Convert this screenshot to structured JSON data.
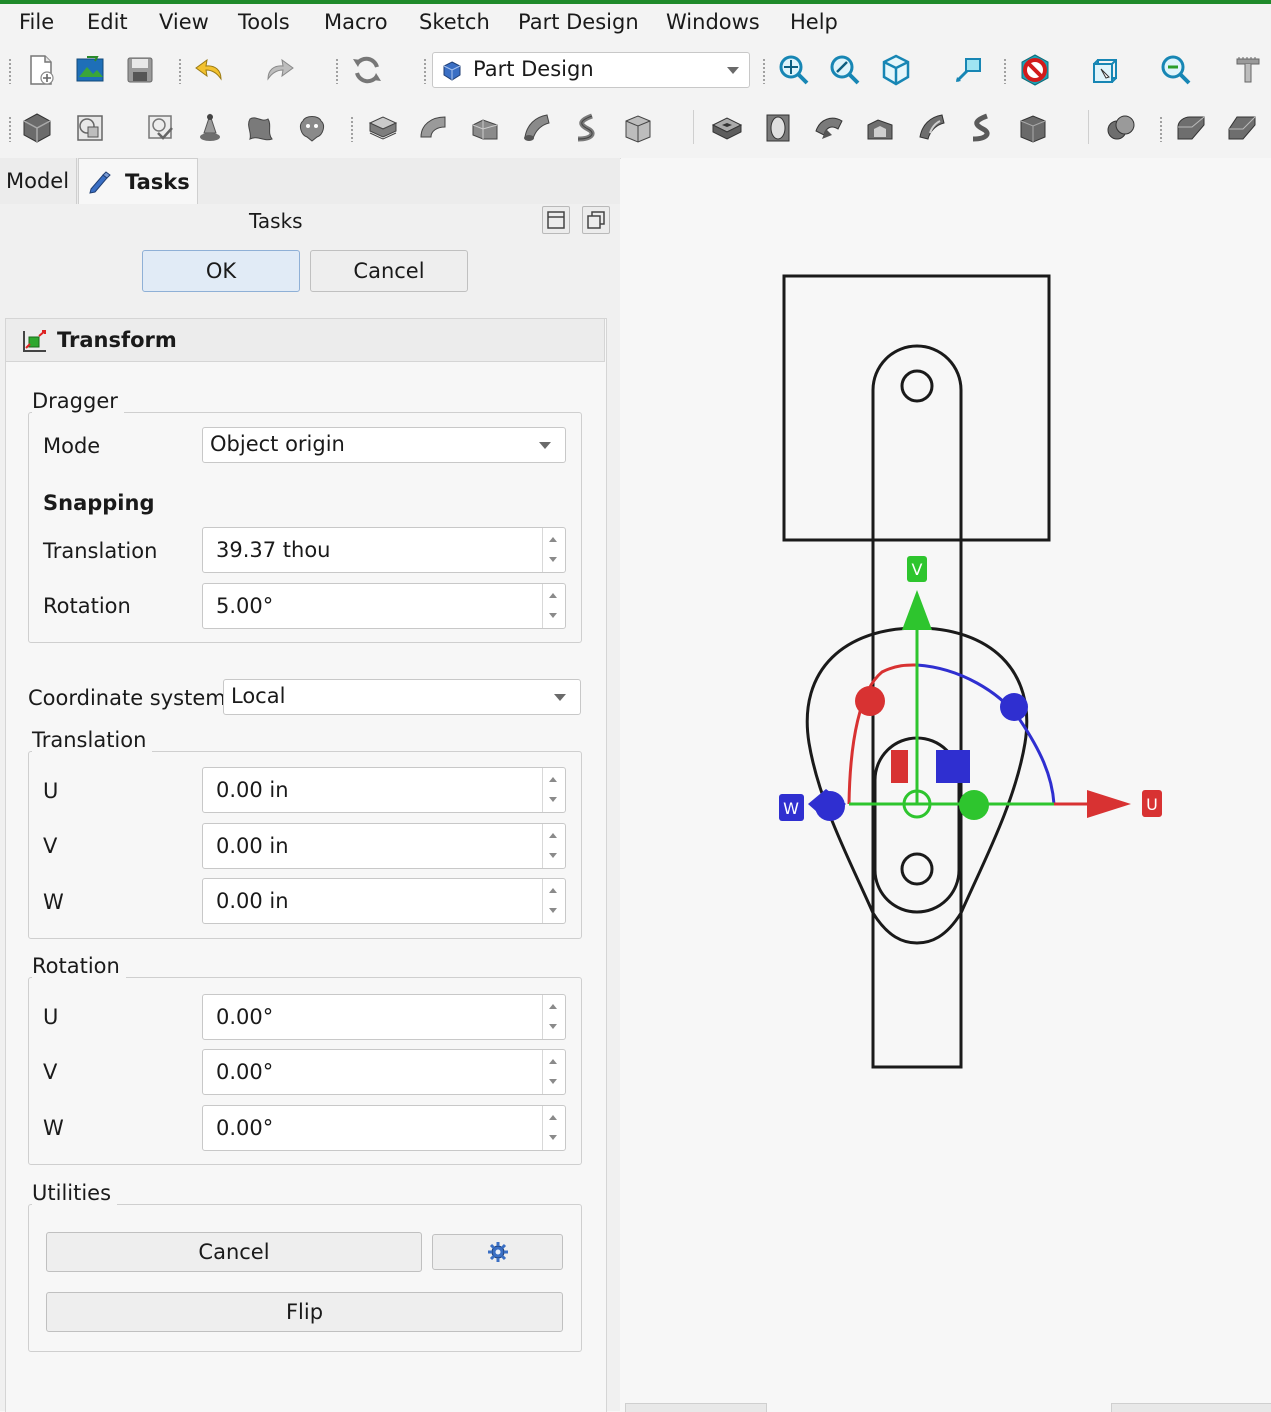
{
  "menu": [
    "File",
    "Edit",
    "View",
    "Tools",
    "Macro",
    "Sketch",
    "Part Design",
    "Windows",
    "Help"
  ],
  "toolbar": {
    "workbench": "Part Design",
    "icons1": [
      "new-file-icon",
      "open-file-icon",
      "save-icon",
      "undo-icon",
      "redo-icon",
      "refresh-icon",
      "fit-all-icon",
      "fit-selection-icon",
      "isometric-view-icon",
      "measure-icon",
      "draw-style-icon",
      "bounding-box-icon",
      "zoom-icon",
      "measure-tool-icon"
    ],
    "icons2": [
      "body-icon",
      "shape-binder-icon",
      "clone-icon",
      "datum-point-icon",
      "datum-plane-icon",
      "datum-feature-icon",
      "pad-icon",
      "revolve-icon",
      "loft-icon",
      "pipe-icon",
      "helix-icon",
      "additive-primitive-icon",
      "pocket-icon",
      "hole-icon",
      "groove-icon",
      "subtractive-loft-icon",
      "subtractive-pipe-icon",
      "subtractive-helix-icon",
      "subtractive-primitive-icon",
      "boolean-icon",
      "fillet-icon",
      "chamfer-icon"
    ]
  },
  "tabs": {
    "model": "Model",
    "tasks": "Tasks"
  },
  "panel": {
    "title": "Tasks",
    "ok": "OK",
    "cancel": "Cancel"
  },
  "transform": {
    "title": "Transform",
    "dragger": {
      "title": "Dragger",
      "mode_label": "Mode",
      "mode_value": "Object origin",
      "snapping": "Snapping",
      "translation_label": "Translation",
      "translation_value": "39.37 thou",
      "rotation_label": "Rotation",
      "rotation_value": "5.00°"
    },
    "coord_label": "Coordinate system",
    "coord_value": "Local",
    "translation": {
      "title": "Translation",
      "u_label": "U",
      "u_value": "0.00 in",
      "v_label": "V",
      "v_value": "0.00 in",
      "w_label": "W",
      "w_value": "0.00 in"
    },
    "rotation": {
      "title": "Rotation",
      "u_label": "U",
      "u_value": "0.00°",
      "v_label": "V",
      "v_value": "0.00°",
      "w_label": "W",
      "w_value": "0.00°"
    },
    "utilities": {
      "title": "Utilities",
      "cancel": "Cancel",
      "flip": "Flip"
    }
  },
  "viewport": {
    "axis_u": "U",
    "axis_v": "V",
    "axis_w": "W",
    "colors": {
      "u": "#d83232",
      "v": "#2ec52e",
      "w": "#2f2fd0"
    }
  }
}
